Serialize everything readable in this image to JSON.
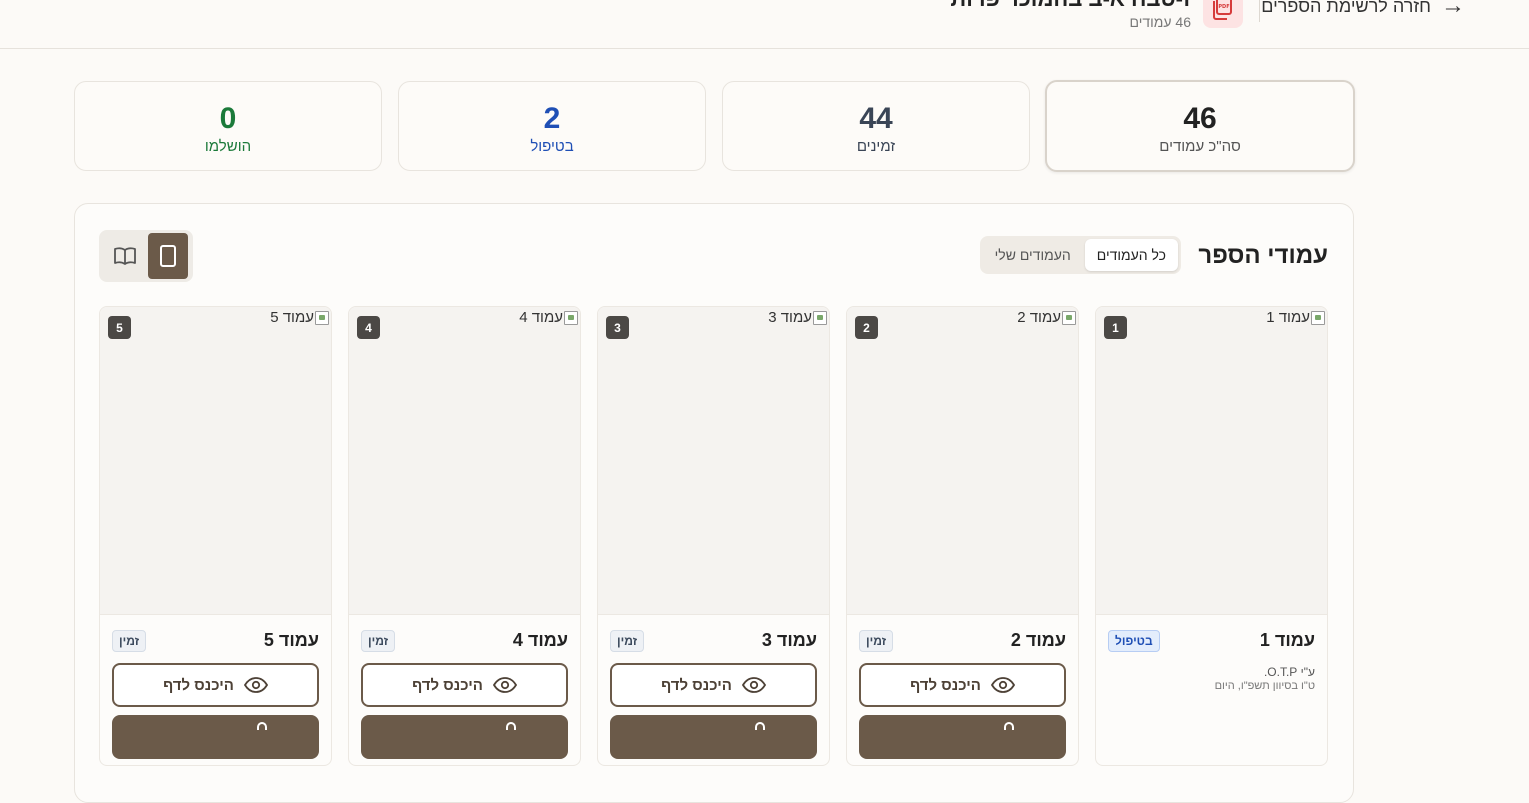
{
  "header": {
    "back_label": "חזרה לרשימת הספרים",
    "book_title": "ז-טבח א-ב בהמוכר פרות",
    "pages_count_label": "46 עמודים"
  },
  "stats": [
    {
      "value": "46",
      "label": "סה\"כ עמודים",
      "color": "#222222"
    },
    {
      "value": "44",
      "label": "זמינים",
      "color": "#3a4556"
    },
    {
      "value": "2",
      "label": "בטיפול",
      "color": "#1f4fb5"
    },
    {
      "value": "0",
      "label": "הושלמו",
      "color": "#1b7a3a"
    }
  ],
  "panel": {
    "title": "עמודי הספר",
    "tabs": [
      {
        "label": "כל העמודים",
        "active": true
      },
      {
        "label": "העמודים שלי",
        "active": false
      }
    ]
  },
  "pages": [
    {
      "alt": "עמוד 1",
      "number": "1",
      "title": "עמוד 1",
      "status": "בטיפול",
      "status_kind": "inprogress",
      "meta_line1": "ע\"י O.T.P.",
      "meta_line2": "ט\"ו בסיוון תשפ\"ו, היום"
    },
    {
      "alt": "עמוד 2",
      "number": "2",
      "title": "עמוד 2",
      "status": "זמין",
      "status_kind": "available",
      "enter_label": "היכנס לדף"
    },
    {
      "alt": "עמוד 3",
      "number": "3",
      "title": "עמוד 3",
      "status": "זמין",
      "status_kind": "available",
      "enter_label": "היכנס לדף"
    },
    {
      "alt": "עמוד 4",
      "number": "4",
      "title": "עמוד 4",
      "status": "זמין",
      "status_kind": "available",
      "enter_label": "היכנס לדף"
    },
    {
      "alt": "עמוד 5",
      "number": "5",
      "title": "עמוד 5",
      "status": "זמין",
      "status_kind": "available",
      "enter_label": "היכנס לדף"
    }
  ],
  "icons": {
    "back": "arrow-right-icon",
    "pdf": "pdf-file-icon",
    "single_view": "single-page-icon",
    "book_view": "open-book-icon",
    "eye": "eye-icon"
  },
  "colors": {
    "accent_brown": "#6b5a49",
    "background": "#fcfaf7",
    "pdf_bg": "#fde3e3",
    "pdf_icon": "#d63a3a"
  }
}
